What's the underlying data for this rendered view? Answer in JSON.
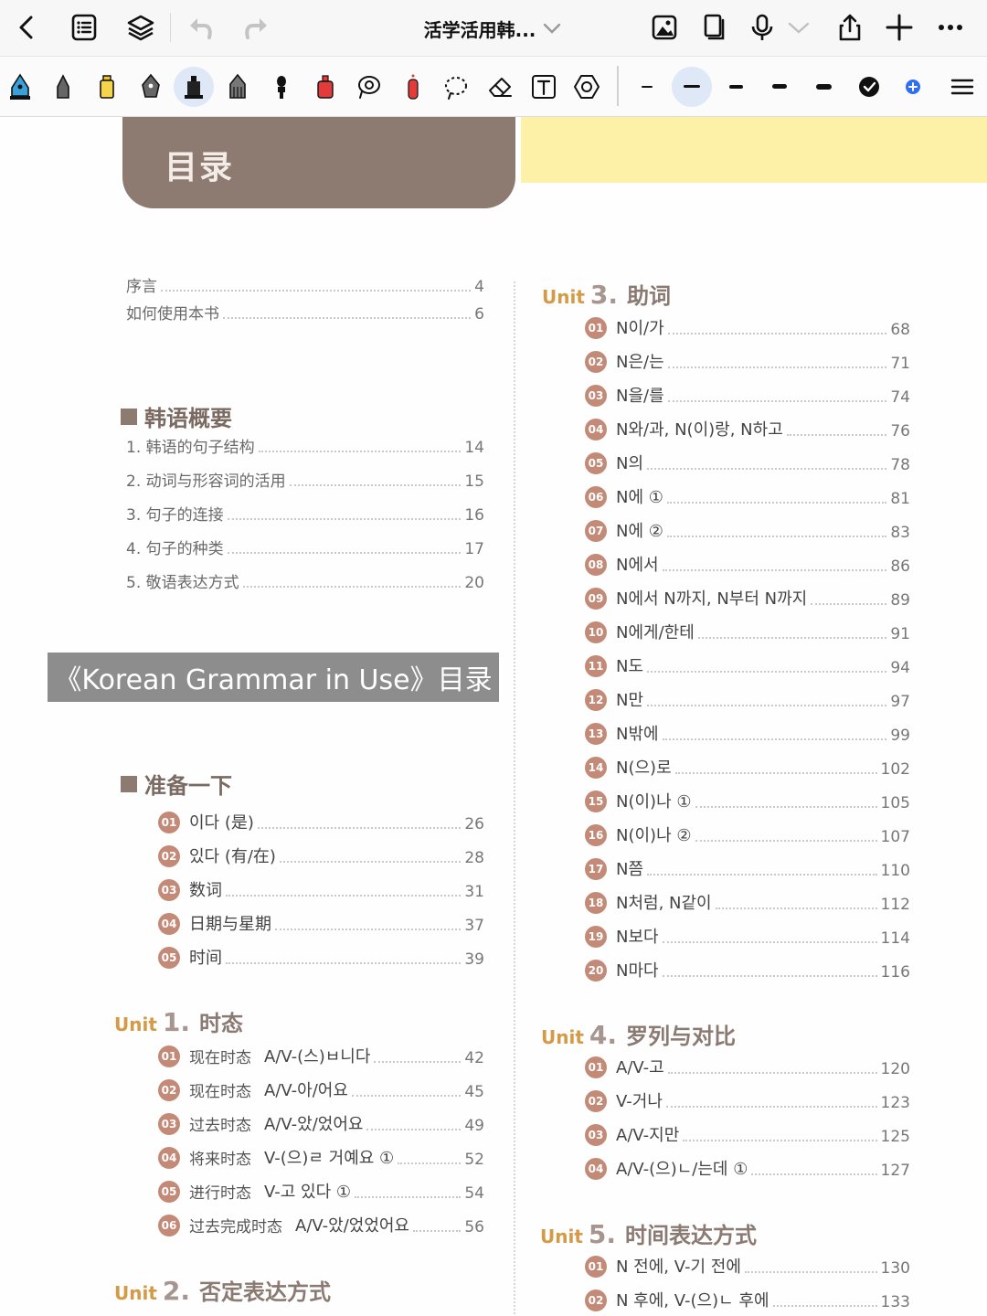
{
  "nav": {
    "title": "活学活用韩...",
    "icons": [
      "back-icon",
      "outline-icon",
      "layers-icon",
      "undo-icon",
      "redo-icon",
      "insert-image-icon",
      "pages-icon",
      "microphone-icon",
      "chevron-down-icon",
      "share-icon",
      "add-icon",
      "more-icon"
    ]
  },
  "toolbar": {
    "tools": [
      "fountain-pen",
      "pen",
      "highlighter",
      "calligraphy-pen",
      "marker",
      "pencil",
      "brush",
      "eraser-red",
      "lasso-search",
      "spray",
      "lasso-select",
      "eraser",
      "text-box",
      "shapes"
    ],
    "colors": [
      "#111111",
      "#2e6ff2"
    ]
  },
  "page": {
    "header_title": "目录",
    "overlay_caption": "《Korean Grammar in Use》目录",
    "front": [
      {
        "label": "序言",
        "page": "4"
      },
      {
        "label": "如何使用本书",
        "page": "6"
      }
    ],
    "overview": {
      "title": "韩语概要",
      "items": [
        {
          "label": "1. 韩语的句子结构",
          "page": "14"
        },
        {
          "label": "2. 动词与形容词的活用",
          "page": "15"
        },
        {
          "label": "3. 句子的连接",
          "page": "16"
        },
        {
          "label": "4. 句子的种类",
          "page": "17"
        },
        {
          "label": "5. 敬语表达方式",
          "page": "20"
        }
      ]
    },
    "prep": {
      "title": "准备一下",
      "items": [
        {
          "num": "01",
          "label": "이다 (是)",
          "page": "26"
        },
        {
          "num": "02",
          "label": "있다 (有/在)",
          "page": "28"
        },
        {
          "num": "03",
          "label": "数词",
          "page": "31"
        },
        {
          "num": "04",
          "label": "日期与星期",
          "page": "37"
        },
        {
          "num": "05",
          "label": "时间",
          "page": "39"
        }
      ]
    },
    "unit1": {
      "unit": "Unit",
      "num": "1.",
      "title": "时态",
      "items": [
        {
          "num": "01",
          "cat": "现在时态",
          "label": "A/V-(스)ㅂ니다",
          "page": "42"
        },
        {
          "num": "02",
          "cat": "现在时态",
          "label": "A/V-아/어요",
          "page": "45"
        },
        {
          "num": "03",
          "cat": "过去时态",
          "label": "A/V-았/었어요",
          "page": "49"
        },
        {
          "num": "04",
          "cat": "将来时态",
          "label": "V-(으)ㄹ 거예요 ①",
          "page": "52"
        },
        {
          "num": "05",
          "cat": "进行时态",
          "label": "V-고 있다 ①",
          "page": "54"
        },
        {
          "num": "06",
          "cat": "过去完成时态",
          "label": "A/V-았/었었어요",
          "page": "56"
        }
      ]
    },
    "unit2": {
      "unit": "Unit",
      "num": "2.",
      "title": "否定表达方式"
    },
    "unit3": {
      "unit": "Unit",
      "num": "3.",
      "title": "助词",
      "items": [
        {
          "num": "01",
          "label": "N이/가",
          "page": "68"
        },
        {
          "num": "02",
          "label": "N은/는",
          "page": "71"
        },
        {
          "num": "03",
          "label": "N을/를",
          "page": "74"
        },
        {
          "num": "04",
          "label": "N와/과, N(이)랑, N하고",
          "page": "76"
        },
        {
          "num": "05",
          "label": "N의",
          "page": "78"
        },
        {
          "num": "06",
          "label": "N에 ①",
          "page": "81"
        },
        {
          "num": "07",
          "label": "N에 ②",
          "page": "83"
        },
        {
          "num": "08",
          "label": "N에서",
          "page": "86"
        },
        {
          "num": "09",
          "label": "N에서 N까지, N부터 N까지",
          "page": "89"
        },
        {
          "num": "10",
          "label": "N에게/한테",
          "page": "91"
        },
        {
          "num": "11",
          "label": "N도",
          "page": "94"
        },
        {
          "num": "12",
          "label": "N만",
          "page": "97"
        },
        {
          "num": "13",
          "label": "N밖에",
          "page": "99"
        },
        {
          "num": "14",
          "label": "N(으)로",
          "page": "102"
        },
        {
          "num": "15",
          "label": "N(이)나 ①",
          "page": "105"
        },
        {
          "num": "16",
          "label": "N(이)나 ②",
          "page": "107"
        },
        {
          "num": "17",
          "label": "N쯤",
          "page": "110"
        },
        {
          "num": "18",
          "label": "N처럼, N같이",
          "page": "112"
        },
        {
          "num": "19",
          "label": "N보다",
          "page": "114"
        },
        {
          "num": "20",
          "label": "N마다",
          "page": "116"
        }
      ]
    },
    "unit4": {
      "unit": "Unit",
      "num": "4.",
      "title": "罗列与对比",
      "items": [
        {
          "num": "01",
          "label": "A/V-고",
          "page": "120"
        },
        {
          "num": "02",
          "label": "V-거나",
          "page": "123"
        },
        {
          "num": "03",
          "label": "A/V-지만",
          "page": "125"
        },
        {
          "num": "04",
          "label": "A/V-(으)ㄴ/는데 ①",
          "page": "127"
        }
      ]
    },
    "unit5": {
      "unit": "Unit",
      "num": "5.",
      "title": "时间表达方式",
      "items": [
        {
          "num": "01",
          "label": "N 전에, V-기 전에",
          "page": "130"
        },
        {
          "num": "02",
          "label": "N 후에, V-(으)ㄴ 후에",
          "page": "133"
        }
      ]
    }
  }
}
